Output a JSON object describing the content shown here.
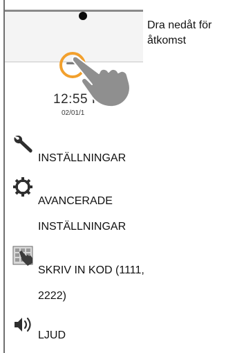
{
  "instruction": {
    "text": "Dra nedåt för åtkomst"
  },
  "lock_screen": {
    "time": "12:55 P",
    "date": "02/01/1"
  },
  "menu": {
    "items": [
      {
        "icon": "wrench-icon",
        "label_lines": [
          "INSTÄLLNINGAR"
        ]
      },
      {
        "icon": "gear-icon",
        "label_lines": [
          "AVANCERADE",
          "INSTÄLLNINGAR"
        ]
      },
      {
        "icon": "keypad-hand-icon",
        "label_lines": [
          "SKRIV IN KOD (1111,",
          "2222)"
        ]
      },
      {
        "icon": "speaker-icon",
        "label_lines": [
          "LJUD"
        ]
      }
    ]
  },
  "colors": {
    "highlight_ring": "#f2a02d",
    "hand": "#8f8f8f",
    "icon": "#2e2e2e"
  }
}
